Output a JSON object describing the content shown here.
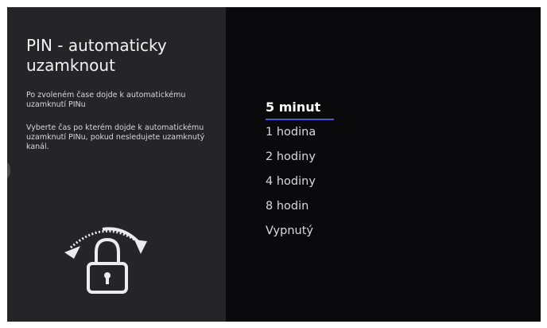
{
  "panel": {
    "title": "PIN - automaticky uzamknout",
    "description_1": "Po zvoleném čase dojde k automatickému uzamknutí PINu",
    "description_2": "Vyberte čas po kterém dojde k automatickému uzamknutí PINu, pokud nesledujete uzamknutý kanál."
  },
  "options": {
    "selected_index": 0,
    "items": [
      "5 minut",
      "1 hodina",
      "2 hodiny",
      "4 hodiny",
      "8 hodin",
      "Vypnutý"
    ]
  },
  "icons": {
    "lock": "lock-icon",
    "rotate_arrow": "rotate-arrow-icon"
  },
  "colors": {
    "accent": "#4f55d8",
    "left_panel": "#252527",
    "background": "#0a0a0c"
  }
}
